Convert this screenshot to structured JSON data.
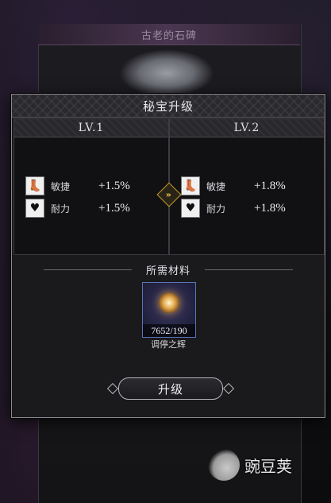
{
  "background": {
    "panel_title": "古老的石碑"
  },
  "dialog": {
    "title": "秘宝升级",
    "current_level": {
      "label": "LV.1",
      "stats": [
        {
          "icon": "boot-icon",
          "name": "敏捷",
          "value": "+1.5%"
        },
        {
          "icon": "heart-hand-icon",
          "name": "耐力",
          "value": "+1.5%"
        }
      ]
    },
    "next_level": {
      "label": "LV.2",
      "stats": [
        {
          "icon": "boot-icon",
          "name": "敏捷",
          "value": "+1.8%"
        },
        {
          "icon": "heart-hand-icon",
          "name": "耐力",
          "value": "+1.8%"
        }
      ]
    },
    "arrow": "»",
    "materials": {
      "label": "所需材料",
      "items": [
        {
          "icon": "star-gem-icon",
          "count": "7652/190",
          "name": "调停之辉"
        }
      ]
    },
    "upgrade_button": "升级"
  },
  "watermark": {
    "text": "豌豆荚"
  },
  "colors": {
    "border": "#8c8a90",
    "arrow_accent": "#f1c04a",
    "material_slot_border": "#5a76b8"
  }
}
